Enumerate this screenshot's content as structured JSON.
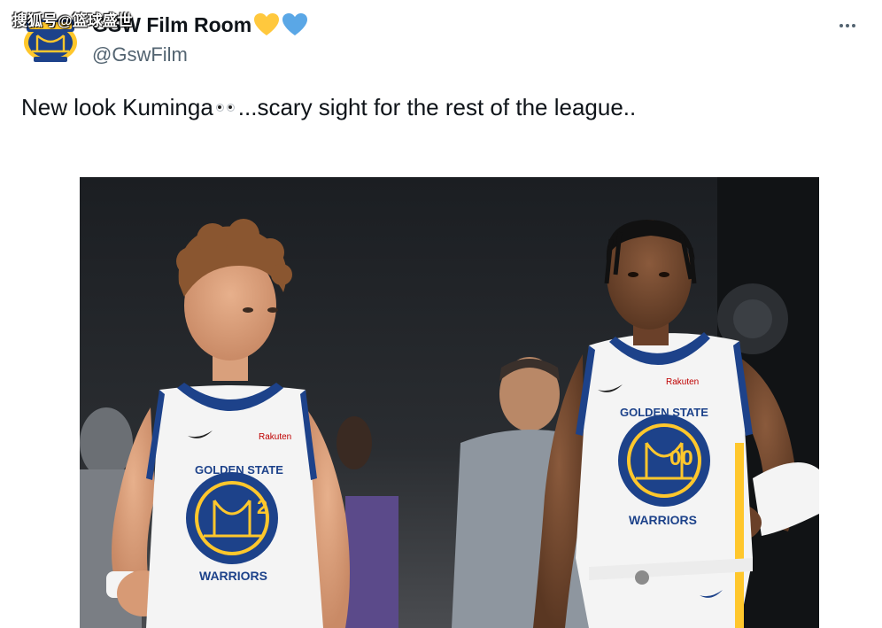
{
  "watermark": "搜狐号@篮球盛世",
  "author": {
    "display_name": "GSW Film Room",
    "handle": "@GswFilm",
    "avatar_icon": "warriors-logo-icon",
    "badge_icons": [
      "yellow-heart-icon",
      "blue-heart-icon"
    ]
  },
  "tweet": {
    "text_before_emoji": "New look Kuminga",
    "emoji": "eyes-emoji",
    "text_after_emoji": "...scary sight for the rest of the league.."
  },
  "media": {
    "left_jersey_number": "2",
    "right_jersey_number": "00",
    "jersey_team_text": "GOLDEN STATE",
    "jersey_team_text_bottom": "WARRIORS",
    "sponsor_text": "Rakuten"
  },
  "colors": {
    "warriors_blue": "#1d428a",
    "warriors_gold": "#ffc72c",
    "text_primary": "#0f1419",
    "text_secondary": "#536471"
  }
}
